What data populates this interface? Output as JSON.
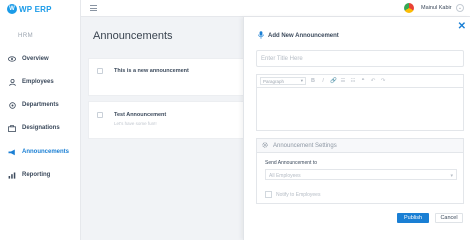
{
  "brand": {
    "logo_mark": "W",
    "name": "WP ERP"
  },
  "sidebar": {
    "section_label": "HRM",
    "items": [
      {
        "label": "Overview",
        "icon": "eye-icon"
      },
      {
        "label": "Employees",
        "icon": "user-icon"
      },
      {
        "label": "Departments",
        "icon": "department-icon"
      },
      {
        "label": "Designations",
        "icon": "briefcase-icon"
      },
      {
        "label": "Announcements",
        "icon": "megaphone-icon",
        "active": true
      },
      {
        "label": "Reporting",
        "icon": "chart-icon"
      }
    ]
  },
  "header": {
    "user_name": "Mainul Kabir",
    "caret": "⌄"
  },
  "page": {
    "title": "Announcements"
  },
  "announcements": [
    {
      "title": "This is a new announcement",
      "subtitle": ""
    },
    {
      "title": "Test Announcement",
      "subtitle": "Let's have some fun!!"
    }
  ],
  "modal": {
    "close": "✕",
    "title": "Add New Announcement",
    "title_placeholder": "Enter Title Here",
    "toolbar": {
      "paragraph": "Paragraph",
      "caret": "▾",
      "bold": "B",
      "italic": "I",
      "link": "🔗",
      "ul": "☰",
      "ol": "☷",
      "quote": "❝",
      "undo": "↶",
      "redo": "↷"
    },
    "settings": {
      "heading": "Announcement Settings",
      "send_label": "Send Announcement to",
      "send_value": "All Employees",
      "send_caret": "▾",
      "notify_label": "Notify to Employees"
    },
    "publish_label": "Publish",
    "cancel_label": "Cancel"
  },
  "colors": {
    "accent": "#1a7fd4",
    "brand": "#1a9be8"
  }
}
